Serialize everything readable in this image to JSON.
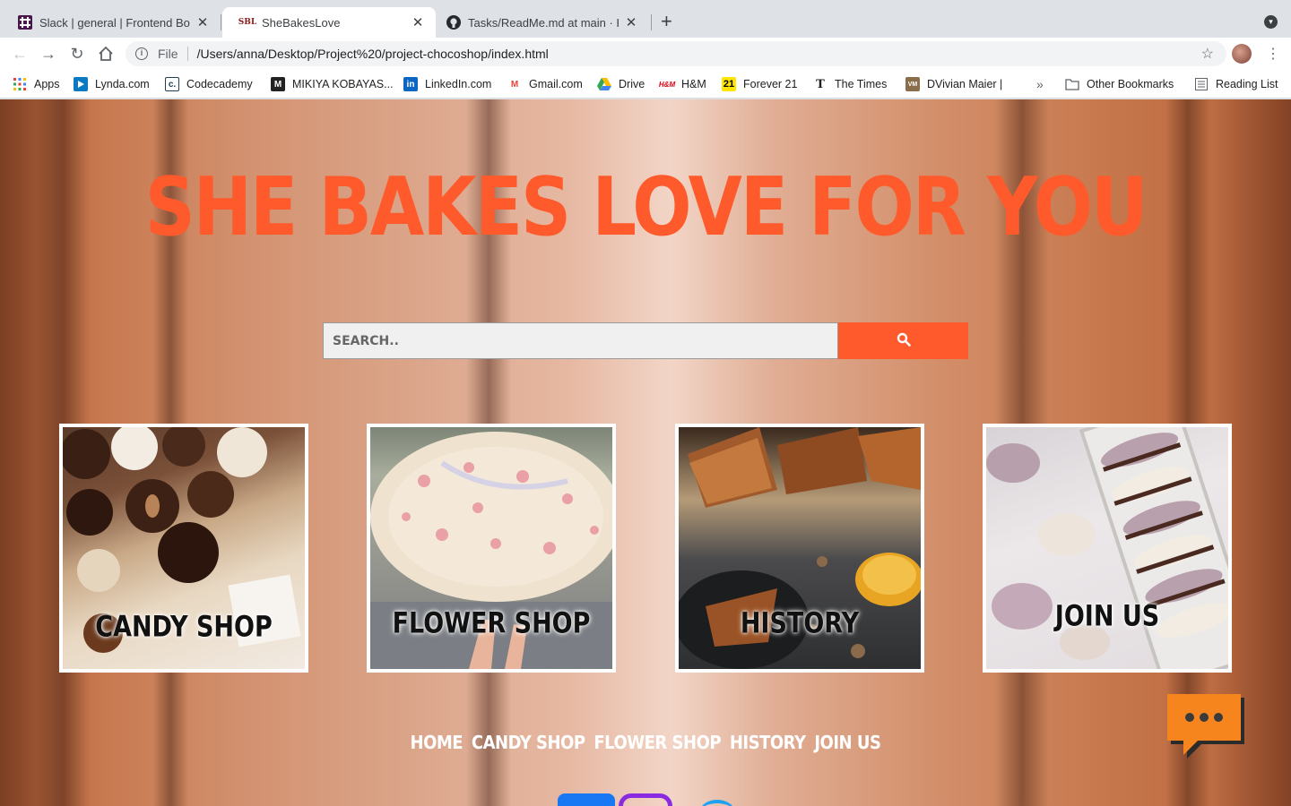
{
  "browser": {
    "tabs": [
      {
        "title": "Slack | general | Frontend Boot",
        "favicon": "slack-icon",
        "close": "✕"
      },
      {
        "title": "SheBakesLove",
        "favicon_text": "SBL",
        "close": "✕"
      },
      {
        "title": "Tasks/ReadMe.md at main · HA",
        "favicon": "github-icon",
        "close": "✕"
      }
    ],
    "url_scheme": "File",
    "url": "/Users/anna/Desktop/Project%20/project-chocoshop/index.html",
    "bookmarks": [
      {
        "label": "Apps",
        "icon": "apps-grid-icon"
      },
      {
        "label": "Lynda.com",
        "icon": "lynda-icon"
      },
      {
        "label": "Codecademy",
        "icon": "codecademy-icon",
        "icon_text": "c."
      },
      {
        "label": "MIKIYA KOBAYAS...",
        "icon": "m-icon",
        "icon_text": "M"
      },
      {
        "label": "LinkedIn.com",
        "icon": "linkedin-icon",
        "icon_text": "in"
      },
      {
        "label": "Gmail.com",
        "icon": "gmail-icon",
        "icon_text": "M"
      },
      {
        "label": "Drive",
        "icon": "drive-icon"
      },
      {
        "label": "H&M",
        "icon": "hm-icon",
        "icon_text": "H&M"
      },
      {
        "label": "Forever 21",
        "icon": "forever21-icon",
        "icon_text": "21"
      },
      {
        "label": "The Times",
        "icon": "times-icon",
        "icon_text": "T"
      },
      {
        "label": "DVivian Maier |",
        "icon": "vm-icon",
        "icon_text": "VM"
      }
    ],
    "bookmarks_overflow": "»",
    "other_bookmarks": "Other Bookmarks",
    "reading_list": "Reading List"
  },
  "page": {
    "title": "She Bakes Love For You",
    "search": {
      "placeholder": "SEARCH..",
      "button_icon": "search-icon"
    },
    "cards": [
      {
        "label": "Candy Shop",
        "image": "chocolate-truffles"
      },
      {
        "label": "Flower Shop",
        "image": "rose-bouquet"
      },
      {
        "label": "History",
        "image": "baklava-pastry"
      },
      {
        "label": "Join Us",
        "image": "macarons-box"
      }
    ],
    "footer_nav": [
      "Home",
      "Candy Shop",
      "Flower Shop",
      "History",
      "Join Us"
    ],
    "colors": {
      "accent": "#ff5a2b",
      "chat": "#f7851d"
    }
  }
}
